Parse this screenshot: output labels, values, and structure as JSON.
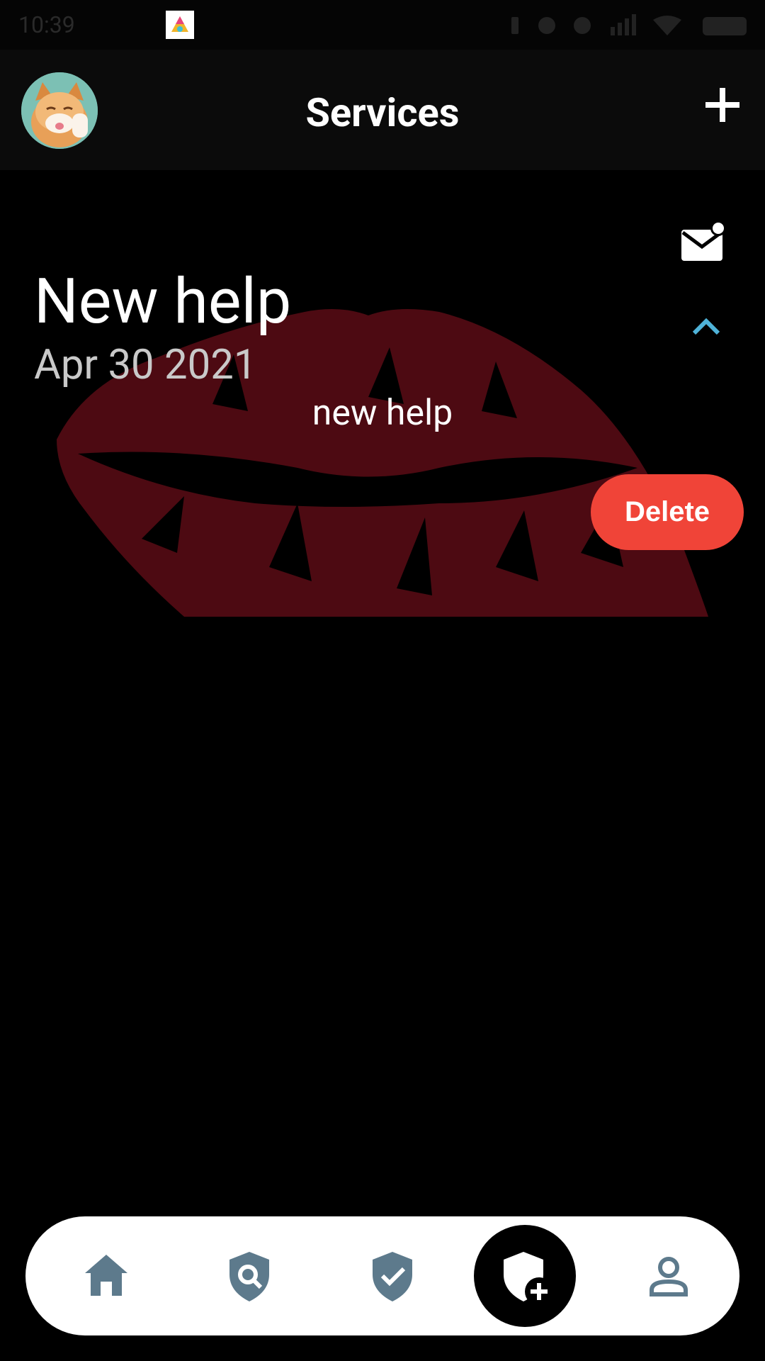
{
  "status_bar": {
    "time": "10:39"
  },
  "header": {
    "title": "Services",
    "add_icon": "plus-icon",
    "avatar": "user-avatar-cat"
  },
  "card": {
    "title": "New help",
    "date": "Apr 30 2021",
    "body": "new help",
    "delete_label": "Delete",
    "mail_icon": "mail-notification-icon",
    "collapse_icon": "chevron-up-icon"
  },
  "bottom_nav": {
    "items": [
      {
        "icon": "home-icon"
      },
      {
        "icon": "shield-search-icon"
      },
      {
        "icon": "shield-check-icon"
      },
      {
        "icon": "shield-add-icon",
        "active": true
      },
      {
        "icon": "person-icon"
      }
    ]
  },
  "colors": {
    "background": "#000000",
    "header_bg": "#0b0b0b",
    "delete_red": "#f04438",
    "accent_blue": "#4fb3d9",
    "nav_icon": "#5d7a8c",
    "lips_red": "#4d0a12"
  }
}
